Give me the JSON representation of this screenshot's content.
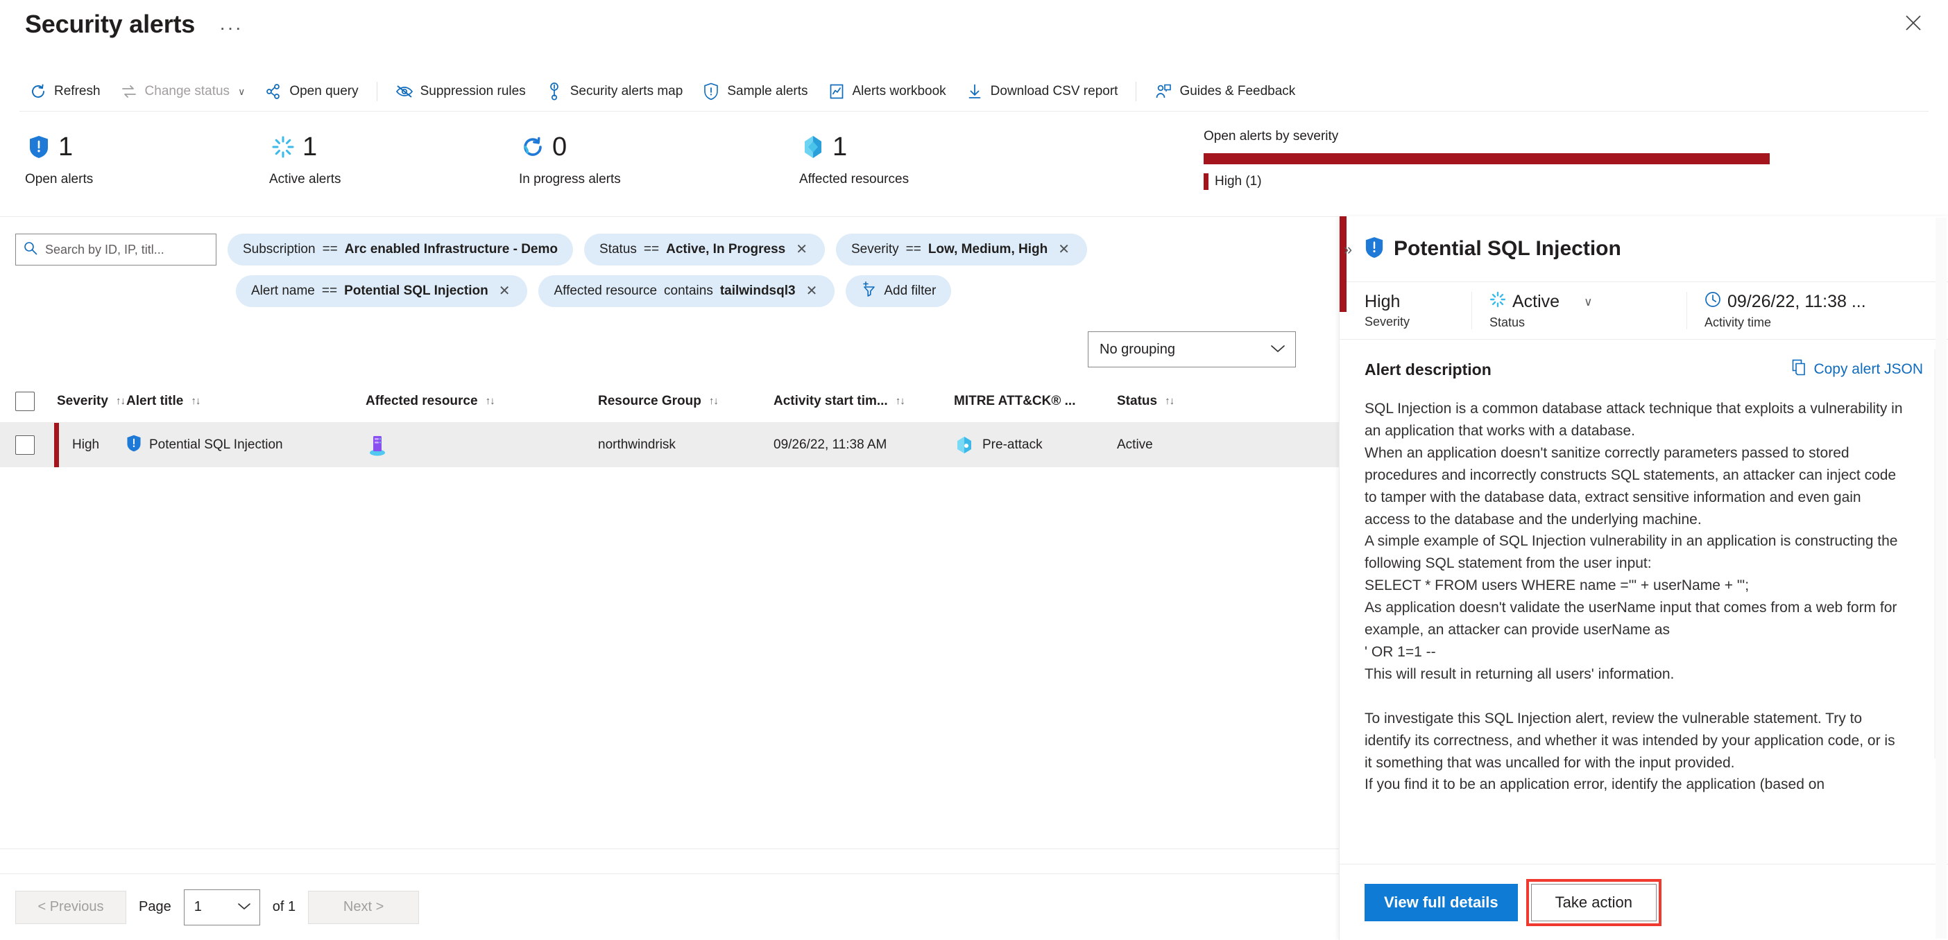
{
  "window": {
    "title": "Security alerts",
    "ellipsis": "···",
    "close_label": "close-icon"
  },
  "toolbar": {
    "items": [
      {
        "label": "Refresh",
        "icon": "refresh-icon",
        "disabled": false
      },
      {
        "label": "Change status",
        "icon": "change-status-icon",
        "disabled": true,
        "caret": "∨"
      },
      {
        "label": "Open query",
        "icon": "open-query-icon",
        "disabled": false
      },
      {
        "label": "Suppression rules",
        "icon": "suppression-rules-icon",
        "disabled": false
      },
      {
        "label": "Security alerts map",
        "icon": "security-alerts-map-icon",
        "disabled": false
      },
      {
        "label": "Sample alerts",
        "icon": "sample-alerts-icon",
        "disabled": false
      },
      {
        "label": "Alerts workbook",
        "icon": "alerts-workbook-icon",
        "disabled": false
      },
      {
        "label": "Download CSV report",
        "icon": "download-icon",
        "disabled": false
      },
      {
        "label": "Guides & Feedback",
        "icon": "guides-feedback-icon",
        "disabled": false
      }
    ]
  },
  "stats": [
    {
      "value": "1",
      "label": "Open alerts",
      "icon": "shield-alert-icon"
    },
    {
      "value": "1",
      "label": "Active alerts",
      "icon": "active-spinner-icon"
    },
    {
      "value": "0",
      "label": "In progress alerts",
      "icon": "in-progress-icon"
    },
    {
      "value": "1",
      "label": "Affected resources",
      "icon": "affected-resources-icon"
    }
  ],
  "severity_summary": {
    "caption": "Open alerts by severity",
    "legend_label": "High (1)",
    "color": "#a4141c",
    "bar_fraction": 1.0
  },
  "filters": {
    "search": {
      "value": "",
      "placeholder": "Search by ID, IP, titl..."
    },
    "pills": [
      {
        "field": "Subscription",
        "op": "==",
        "value": "Arc enabled Infrastructure - Demo",
        "dismissable": false
      },
      {
        "field": "Status",
        "op": "==",
        "value": "Active, In Progress",
        "dismissable": true
      },
      {
        "field": "Severity",
        "op": "==",
        "value": "Low, Medium, High",
        "dismissable": true
      },
      {
        "field": "Alert name",
        "op": "==",
        "value": "Potential SQL Injection",
        "dismissable": true
      },
      {
        "field": "Affected resource",
        "op": "contains",
        "value": "tailwindsql3",
        "dismissable": true
      }
    ],
    "add_filter_label": "Add filter",
    "grouping": {
      "value": "No grouping"
    }
  },
  "table": {
    "columns": [
      {
        "label": "Severity",
        "sortable": true
      },
      {
        "label": "Alert title",
        "sortable": true
      },
      {
        "label": "Affected resource",
        "sortable": true
      },
      {
        "label": "Resource Group",
        "sortable": true
      },
      {
        "label": "Activity start tim...",
        "sortable": true
      },
      {
        "label": "MITRE ATT&CK® ...",
        "sortable": false
      },
      {
        "label": "Status",
        "sortable": true
      }
    ],
    "rows": [
      {
        "severity": "High",
        "alert_title": "Potential SQL Injection",
        "affected_resource": "",
        "affected_resource_icon": "sql-server-icon",
        "resource_group": "northwindrisk",
        "activity_start_time": "09/26/22, 11:38 AM",
        "mitre": "Pre-attack",
        "mitre_icon": "mitre-preattack-icon",
        "status": "Active",
        "selected": true
      }
    ]
  },
  "pagination": {
    "previous_label": "< Previous",
    "page_label": "Page",
    "page_value": "1",
    "of_label": "of 1",
    "next_label": "Next >"
  },
  "detail_panel": {
    "title": "Potential SQL Injection",
    "title_icon": "shield-alert-icon",
    "severity": {
      "value": "High",
      "key": "Severity"
    },
    "status": {
      "value": "Active",
      "key": "Status",
      "icon": "active-spinner-icon",
      "caret": "∨"
    },
    "activity_time": {
      "value": "09/26/22, 11:38 ...",
      "key": "Activity time",
      "icon": "clock-icon"
    },
    "description_heading": "Alert description",
    "copy_json_label": "Copy alert JSON",
    "description": "SQL Injection is a common database attack technique that exploits a vulnerability in an application that works with a database.\nWhen an application doesn't sanitize correctly parameters passed to stored procedures and incorrectly constructs SQL statements, an attacker can inject code to tamper with the database data, extract sensitive information and even gain access to the database and the underlying machine.\nA simple example of SQL Injection vulnerability in an application is constructing the following SQL statement from the user input:\nSELECT * FROM users WHERE name ='\" + userName + \"';\nAs application doesn't validate the userName input that comes from a web form for example, an attacker can provide userName as\n' OR 1=1 --\nThis will result in returning all users' information.\n\nTo investigate this SQL Injection alert, review the vulnerable statement. Try to identify its correctness, and whether it was intended by your application code, or is it something that was uncalled for with the input provided.\nIf you find it to be an application error, identify the application (based on",
    "primary_button": "View full details",
    "secondary_button": "Take action",
    "secondary_button_highlight_color": "#f03a2f",
    "expand_icon": "chevron-double-right-icon"
  }
}
